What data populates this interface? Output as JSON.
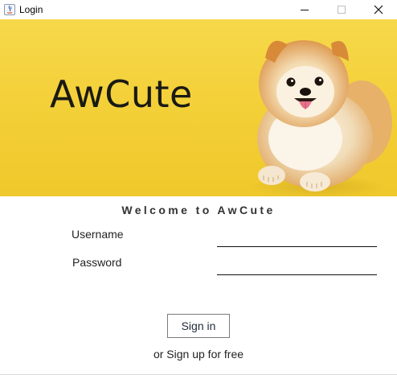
{
  "window": {
    "title": "Login",
    "controls": {
      "minimize_icon": "minimize-icon",
      "maximize_icon": "maximize-icon",
      "close_icon": "close-icon"
    }
  },
  "banner": {
    "brand": "AwCute",
    "background_color": "#F3CF36",
    "image": "pomeranian-dog"
  },
  "form": {
    "welcome": "Welcome to AwCute",
    "username_label": "Username",
    "username_value": "",
    "password_label": "Password",
    "password_value": "",
    "signin_label": "Sign in",
    "signup_link": "or Sign up for free"
  }
}
